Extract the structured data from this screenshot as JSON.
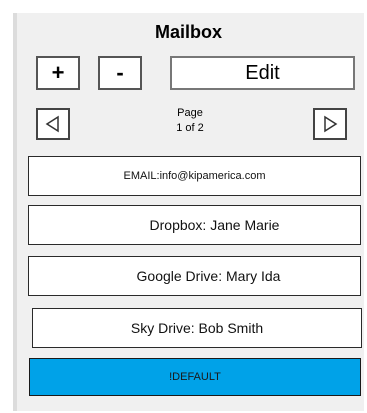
{
  "mailbox": {
    "title": "Mailbox",
    "add_label": "+",
    "remove_label": "-",
    "edit_label": "Edit",
    "page_label": "Page",
    "page_of": "1 of 2",
    "items": [
      {
        "label": "EMAIL:info@kipamerica.com"
      },
      {
        "label": "Dropbox: Jane Marie"
      },
      {
        "label": "Google Drive: Mary Ida"
      },
      {
        "label": "Sky Drive: Bob Smith"
      }
    ],
    "default_label": "!DEFAULT",
    "colors": {
      "default_bg": "#00a2e8",
      "panel_bg": "#f0f0f0"
    },
    "icons": {
      "prev": "triangle-left-icon",
      "next": "triangle-right-icon"
    }
  }
}
